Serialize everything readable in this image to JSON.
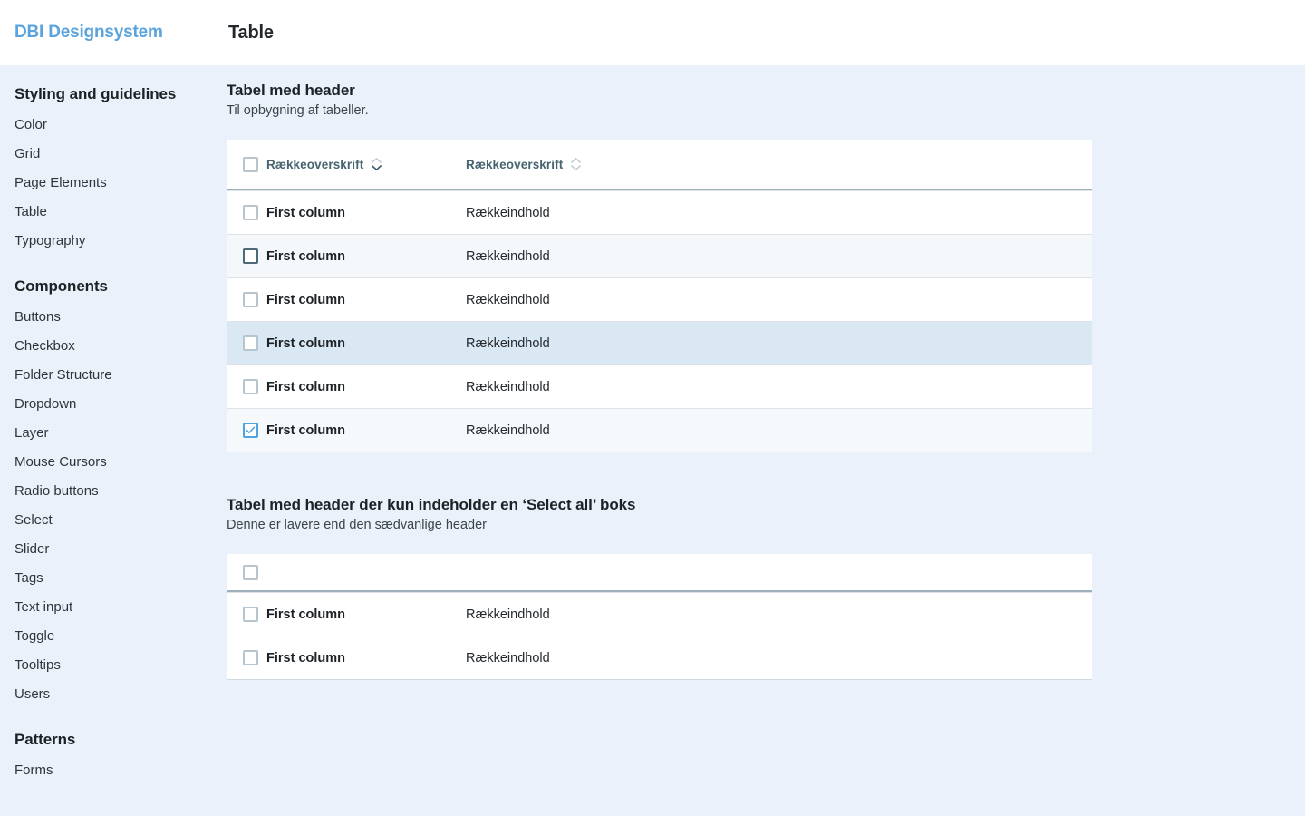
{
  "header": {
    "brand": "DBI Designsystem",
    "page_title": "Table"
  },
  "sidebar": {
    "groups": [
      {
        "heading": "Styling and guidelines",
        "items": [
          "Color",
          "Grid",
          "Page Elements",
          "Table",
          "Typography"
        ]
      },
      {
        "heading": "Components",
        "items": [
          "Buttons",
          "Checkbox",
          "Folder Structure",
          "Dropdown",
          "Layer",
          "Mouse Cursors",
          "Radio buttons",
          "Select",
          "Slider",
          "Tags",
          "Text input",
          "Toggle",
          "Tooltips",
          "Users"
        ]
      },
      {
        "heading": "Patterns",
        "items": [
          "Forms"
        ]
      }
    ]
  },
  "sections": [
    {
      "title": "Tabel med header",
      "subtitle": "Til opbygning af tabeller.",
      "header": {
        "col_a": "Rækkeoverskrift",
        "col_b": "Rækkeoverskrift",
        "sort_a": "sort-icon",
        "sort_b": "sort-icon",
        "select_all": "select-all-checkbox"
      },
      "rows": [
        {
          "first": "First column",
          "content": "Rækkeindhold",
          "state": "default",
          "checked": false
        },
        {
          "first": "First column",
          "content": "Rækkeindhold",
          "state": "hover",
          "checked": false
        },
        {
          "first": "First column",
          "content": "Rækkeindhold",
          "state": "default",
          "checked": false
        },
        {
          "first": "First column",
          "content": "Rækkeindhold",
          "state": "selected",
          "checked": false
        },
        {
          "first": "First column",
          "content": "Rækkeindhold",
          "state": "default",
          "checked": false
        },
        {
          "first": "First column",
          "content": "Rækkeindhold",
          "state": "checked",
          "checked": true
        }
      ]
    },
    {
      "title": "Tabel med header der kun indeholder en ‘Select all’ boks",
      "subtitle": "Denne er lavere end den sædvanlige header",
      "header": {
        "col_a": "",
        "col_b": "",
        "select_all": "select-all-checkbox"
      },
      "rows": [
        {
          "first": "First column",
          "content": "Rækkeindhold",
          "state": "default",
          "checked": false
        },
        {
          "first": "First column",
          "content": "Rækkeindhold",
          "state": "default",
          "checked": false
        }
      ]
    }
  ],
  "colors": {
    "brand": "#5ba3dc",
    "page_background": "#eaf1fa",
    "row_selected": "#d9e8f3",
    "row_hover": "#f5f8fb",
    "row_checked": "#f5f9fc",
    "header_text": "#47646f",
    "checkbox_border": "#b7c5ce",
    "checkbox_border_dark": "#4b6976",
    "checkbox_active": "#4fa3e0",
    "divider": "#dde3e8",
    "header_divider": "#9db0bb"
  }
}
